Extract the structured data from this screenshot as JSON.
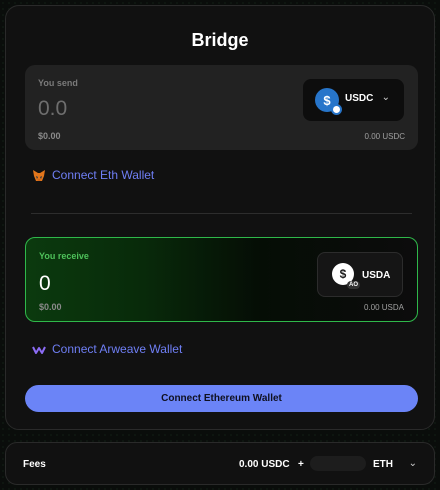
{
  "title": "Bridge",
  "send": {
    "label": "You send",
    "amount": "0.0",
    "usd_value": "$0.00",
    "token": "USDC",
    "token_icon": "usdc-icon",
    "balance": "0.00 USDC"
  },
  "connect_eth_link": "Connect Eth Wallet",
  "receive": {
    "label": "You receive",
    "amount": "0",
    "usd_value": "$0.00",
    "token": "USDA",
    "token_icon": "usda-icon",
    "token_badge": "AO",
    "balance": "0.00 USDA"
  },
  "connect_arweave_link": "Connect Arweave Wallet",
  "primary_button": "Connect Ethereum Wallet",
  "fees": {
    "label": "Fees",
    "usdc_amount": "0.00 USDC",
    "plus": "+",
    "eth_unit": "ETH"
  },
  "colors": {
    "accent": "#6b84f7",
    "link": "#6f7ff5",
    "receive_border": "#2fb84a",
    "usdc_blue": "#2775ca"
  }
}
